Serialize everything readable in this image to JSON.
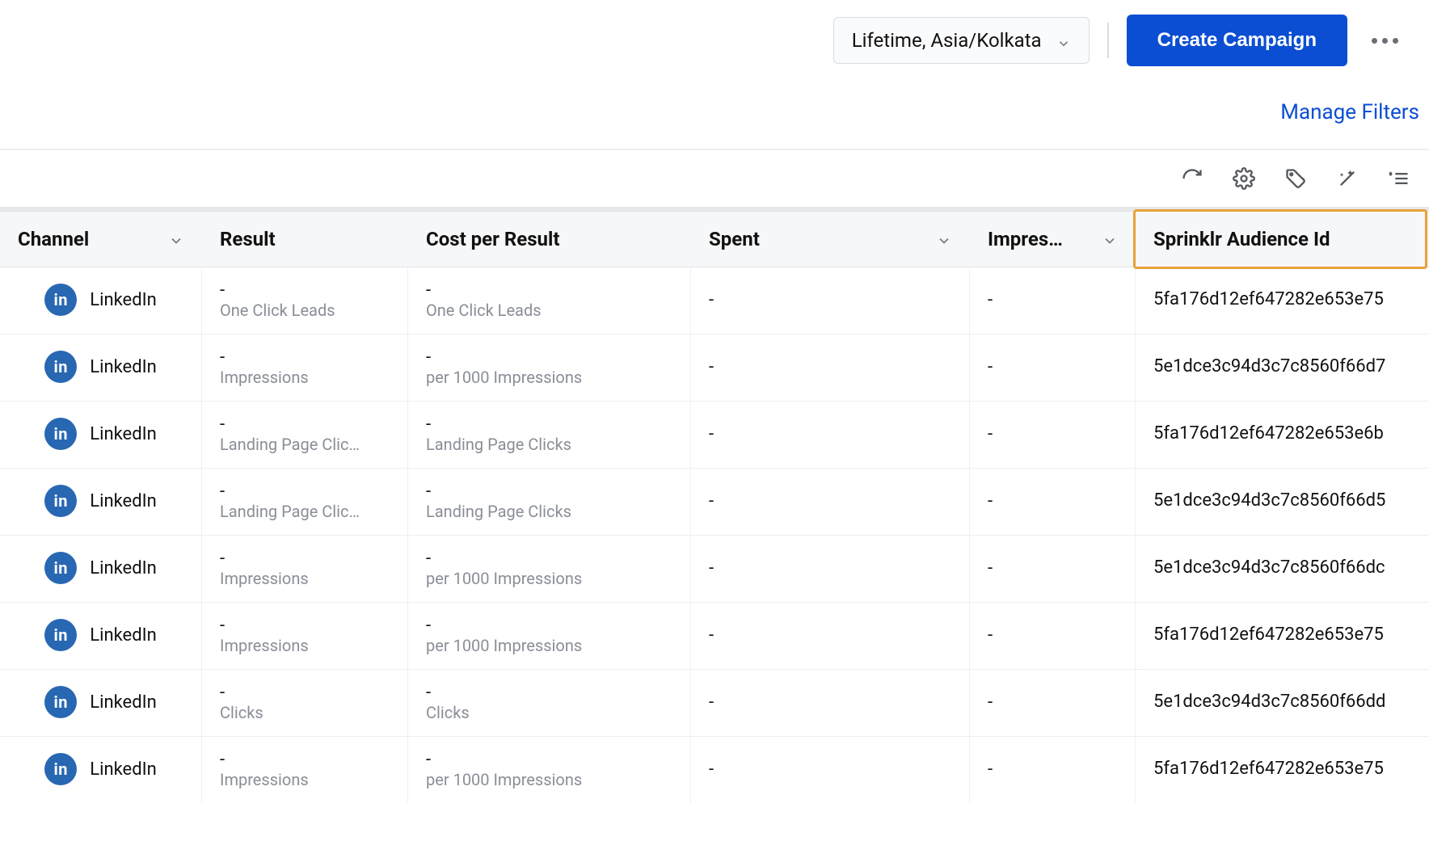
{
  "header": {
    "date_range_label": "Lifetime, Asia/Kolkata",
    "create_campaign_label": "Create Campaign"
  },
  "filters": {
    "manage_filters_label": "Manage Filters"
  },
  "columns": {
    "channel": "Channel",
    "result": "Result",
    "cost_per_result": "Cost per Result",
    "spent": "Spent",
    "impressions": "Impres…",
    "audience_id": "Sprinklr Audience Id"
  },
  "channel_label": "LinkedIn",
  "linkedin_badge_text": "in",
  "rows": [
    {
      "result_main": "-",
      "result_sub": "One Click Leads",
      "cpr_main": "-",
      "cpr_sub": "One Click Leads",
      "spent": "-",
      "impressions": "-",
      "audience_id": "5fa176d12ef647282e653e75"
    },
    {
      "result_main": "-",
      "result_sub": "Impressions",
      "cpr_main": "-",
      "cpr_sub": "per 1000 Impressions",
      "spent": "-",
      "impressions": "-",
      "audience_id": "5e1dce3c94d3c7c8560f66d7"
    },
    {
      "result_main": "-",
      "result_sub": "Landing Page Clic…",
      "cpr_main": "-",
      "cpr_sub": "Landing Page Clicks",
      "spent": "-",
      "impressions": "-",
      "audience_id": "5fa176d12ef647282e653e6b"
    },
    {
      "result_main": "-",
      "result_sub": "Landing Page Clic…",
      "cpr_main": "-",
      "cpr_sub": "Landing Page Clicks",
      "spent": "-",
      "impressions": "-",
      "audience_id": "5e1dce3c94d3c7c8560f66d5"
    },
    {
      "result_main": "-",
      "result_sub": "Impressions",
      "cpr_main": "-",
      "cpr_sub": "per 1000 Impressions",
      "spent": "-",
      "impressions": "-",
      "audience_id": "5e1dce3c94d3c7c8560f66dc"
    },
    {
      "result_main": "-",
      "result_sub": "Impressions",
      "cpr_main": "-",
      "cpr_sub": "per 1000 Impressions",
      "spent": "-",
      "impressions": "-",
      "audience_id": "5fa176d12ef647282e653e75"
    },
    {
      "result_main": "-",
      "result_sub": "Clicks",
      "cpr_main": "-",
      "cpr_sub": "Clicks",
      "spent": "-",
      "impressions": "-",
      "audience_id": "5e1dce3c94d3c7c8560f66dd"
    },
    {
      "result_main": "-",
      "result_sub": "Impressions",
      "cpr_main": "-",
      "cpr_sub": "per 1000 Impressions",
      "spent": "-",
      "impressions": "-",
      "audience_id": "5fa176d12ef647282e653e75"
    }
  ]
}
